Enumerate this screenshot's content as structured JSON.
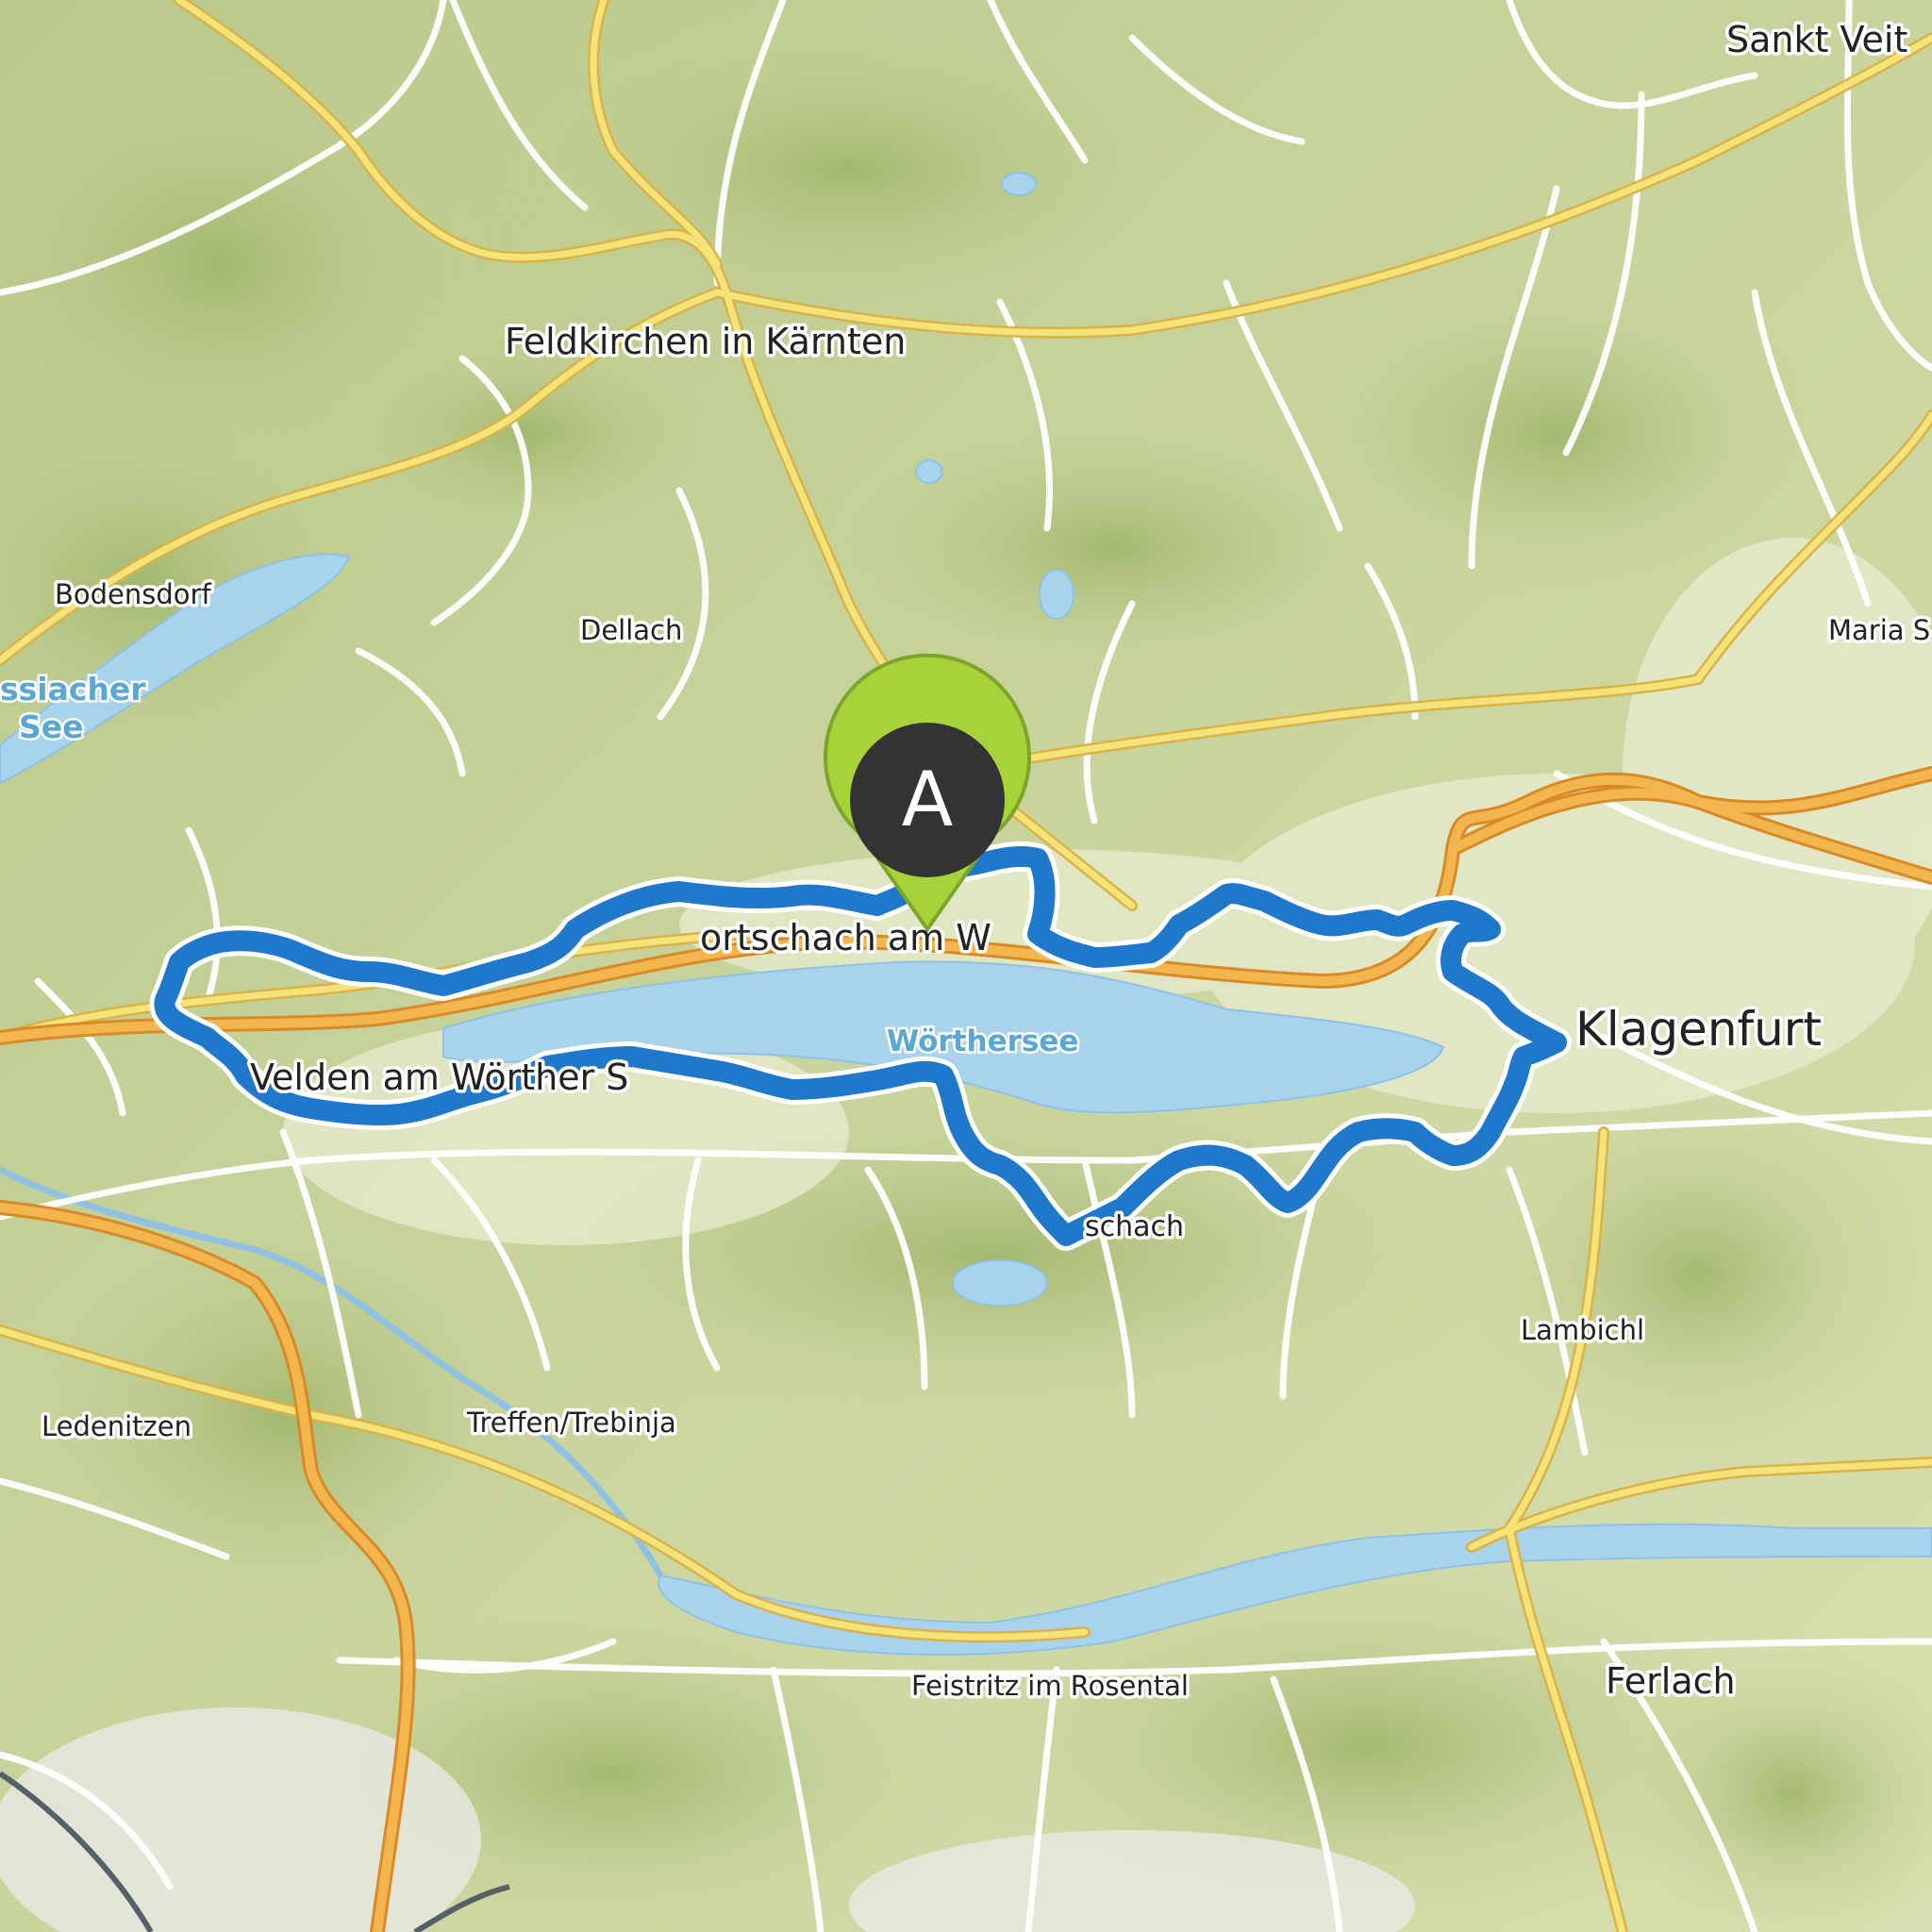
{
  "map": {
    "route_color": "#1f78c9",
    "marker": {
      "label": "A",
      "ring_color": "#a6d33a",
      "fill_color": "#333333"
    },
    "places": [
      {
        "name": "Sankt Veit",
        "size": "medium"
      },
      {
        "name": "Feldkirchen in Kärnten",
        "size": "medium"
      },
      {
        "name": "Bodensdorf",
        "size": "small"
      },
      {
        "name": "Dellach",
        "size": "small"
      },
      {
        "name": "Maria S",
        "size": "small"
      },
      {
        "name": "Klagenfurt",
        "size": "large"
      },
      {
        "name": "ortschach am W",
        "size": "medium"
      },
      {
        "name": "Velden am Wörther S",
        "size": "medium"
      },
      {
        "name": "schach",
        "size": "small"
      },
      {
        "name": "Lambichl",
        "size": "small"
      },
      {
        "name": "Ledenitzen",
        "size": "small"
      },
      {
        "name": "Treffen/Trebinja",
        "size": "small"
      },
      {
        "name": "Ferlach",
        "size": "medium"
      },
      {
        "name": "Feistritz im Rosental",
        "size": "small"
      }
    ],
    "lakes": [
      {
        "line1": "ssiacher",
        "line2": "See"
      },
      {
        "line1": "Wörthersee",
        "line2": ""
      }
    ]
  }
}
